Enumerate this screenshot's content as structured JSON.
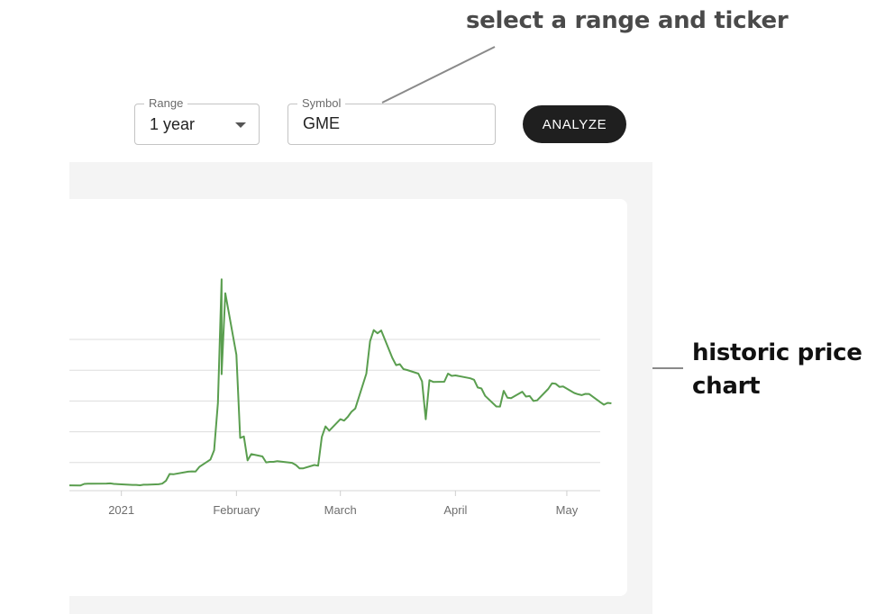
{
  "annotations": {
    "top": "select a range and ticker",
    "right_line1": "historic price",
    "right_line2": "chart"
  },
  "controls": {
    "range": {
      "label": "Range",
      "value": "1 year"
    },
    "symbol": {
      "label": "Symbol",
      "value": "GME"
    },
    "analyze_label": "ANALYZE"
  },
  "colors": {
    "line": "#5a9e4f",
    "grid": "#dddddd",
    "button": "#1f1f1f",
    "panel": "#f4f4f4"
  },
  "chart_data": {
    "type": "line",
    "title": "",
    "xlabel": "",
    "ylabel": "",
    "x_tick_labels": [
      "2021",
      "February",
      "March",
      "April",
      "May"
    ],
    "x_ticks": [
      "2021-01-01",
      "2021-02-01",
      "2021-03-01",
      "2021-04-01",
      "2021-05-01"
    ],
    "xlim": [
      "2020-12-18",
      "2021-05-10"
    ],
    "ylim": [
      0,
      500
    ],
    "y_gridlines": [
      0,
      50,
      100,
      150,
      200,
      250
    ],
    "y_tick_labels_visible": false,
    "grid": true,
    "series": [
      {
        "points": [
          [
            "2020-12-18",
            13.0
          ],
          [
            "2020-12-21",
            12.9
          ],
          [
            "2020-12-22",
            15.3
          ],
          [
            "2020-12-23",
            15.8
          ],
          [
            "2020-12-24",
            15.8
          ],
          [
            "2020-12-28",
            16.0
          ],
          [
            "2020-12-29",
            16.2
          ],
          [
            "2020-12-30",
            15.4
          ],
          [
            "2020-12-31",
            15.1
          ],
          [
            "2021-01-04",
            13.8
          ],
          [
            "2021-01-05",
            13.7
          ],
          [
            "2021-01-06",
            13.2
          ],
          [
            "2021-01-07",
            14.0
          ],
          [
            "2021-01-08",
            14.0
          ],
          [
            "2021-01-11",
            14.7
          ],
          [
            "2021-01-12",
            15.8
          ],
          [
            "2021-01-13",
            20.3
          ],
          [
            "2021-01-14",
            31.4
          ],
          [
            "2021-01-15",
            31.0
          ],
          [
            "2021-01-19",
            35.2
          ],
          [
            "2021-01-20",
            35.6
          ],
          [
            "2021-01-21",
            35.5
          ],
          [
            "2021-01-22",
            43.0
          ],
          [
            "2021-01-25",
            55.0
          ],
          [
            "2021-01-26",
            70.0
          ],
          [
            "2021-01-27",
            147.0
          ],
          [
            "2021-01-28",
            347.5
          ],
          [
            "2021-01-28",
            193.6
          ],
          [
            "2021-01-29",
            325.0
          ],
          [
            "2021-02-01",
            225.0
          ],
          [
            "2021-02-02",
            90.0
          ],
          [
            "2021-02-03",
            92.4
          ],
          [
            "2021-02-04",
            53.5
          ],
          [
            "2021-02-05",
            63.8
          ],
          [
            "2021-02-08",
            60.0
          ],
          [
            "2021-02-09",
            50.3
          ],
          [
            "2021-02-10",
            51.2
          ],
          [
            "2021-02-11",
            51.1
          ],
          [
            "2021-02-12",
            52.4
          ],
          [
            "2021-02-16",
            49.5
          ],
          [
            "2021-02-17",
            46.0
          ],
          [
            "2021-02-18",
            40.7
          ],
          [
            "2021-02-19",
            40.6
          ],
          [
            "2021-02-22",
            46.0
          ],
          [
            "2021-02-23",
            44.9
          ],
          [
            "2021-02-24",
            91.7
          ],
          [
            "2021-02-25",
            108.7
          ],
          [
            "2021-02-26",
            101.7
          ],
          [
            "2021-03-01",
            120.4
          ],
          [
            "2021-03-02",
            118.2
          ],
          [
            "2021-03-03",
            124.2
          ],
          [
            "2021-03-04",
            132.4
          ],
          [
            "2021-03-05",
            137.7
          ],
          [
            "2021-03-08",
            194.5
          ],
          [
            "2021-03-09",
            246.9
          ],
          [
            "2021-03-10",
            265.0
          ],
          [
            "2021-03-11",
            260.0
          ],
          [
            "2021-03-12",
            264.5
          ],
          [
            "2021-03-15",
            220.1
          ],
          [
            "2021-03-16",
            208.2
          ],
          [
            "2021-03-17",
            209.8
          ],
          [
            "2021-03-18",
            201.8
          ],
          [
            "2021-03-19",
            200.3
          ],
          [
            "2021-03-22",
            194.5
          ],
          [
            "2021-03-23",
            181.8
          ],
          [
            "2021-03-24",
            120.3
          ],
          [
            "2021-03-25",
            183.8
          ],
          [
            "2021-03-26",
            181.0
          ],
          [
            "2021-03-29",
            181.3
          ],
          [
            "2021-03-30",
            194.5
          ],
          [
            "2021-03-31",
            190.8
          ],
          [
            "2021-04-01",
            191.5
          ],
          [
            "2021-04-05",
            186.9
          ],
          [
            "2021-04-06",
            184.5
          ],
          [
            "2021-04-07",
            172.0
          ],
          [
            "2021-04-08",
            170.3
          ],
          [
            "2021-04-09",
            158.4
          ],
          [
            "2021-04-12",
            141.1
          ],
          [
            "2021-04-13",
            140.9
          ],
          [
            "2021-04-14",
            166.5
          ],
          [
            "2021-04-15",
            155.4
          ],
          [
            "2021-04-16",
            154.7
          ],
          [
            "2021-04-19",
            165.0
          ],
          [
            "2021-04-20",
            157.2
          ],
          [
            "2021-04-21",
            158.0
          ],
          [
            "2021-04-22",
            150.0
          ],
          [
            "2021-04-23",
            151.0
          ],
          [
            "2021-04-26",
            169.6
          ],
          [
            "2021-04-27",
            178.7
          ],
          [
            "2021-04-28",
            177.9
          ],
          [
            "2021-04-29",
            172.9
          ],
          [
            "2021-04-30",
            173.6
          ],
          [
            "2021-05-03",
            163.0
          ],
          [
            "2021-05-04",
            161.0
          ],
          [
            "2021-05-05",
            159.5
          ],
          [
            "2021-05-06",
            161.5
          ],
          [
            "2021-05-07",
            161.4
          ],
          [
            "2021-05-10",
            148.1
          ],
          [
            "2021-05-11",
            144.0
          ],
          [
            "2021-05-12",
            147.0
          ],
          [
            "2021-05-13",
            146.2
          ]
        ]
      }
    ]
  }
}
